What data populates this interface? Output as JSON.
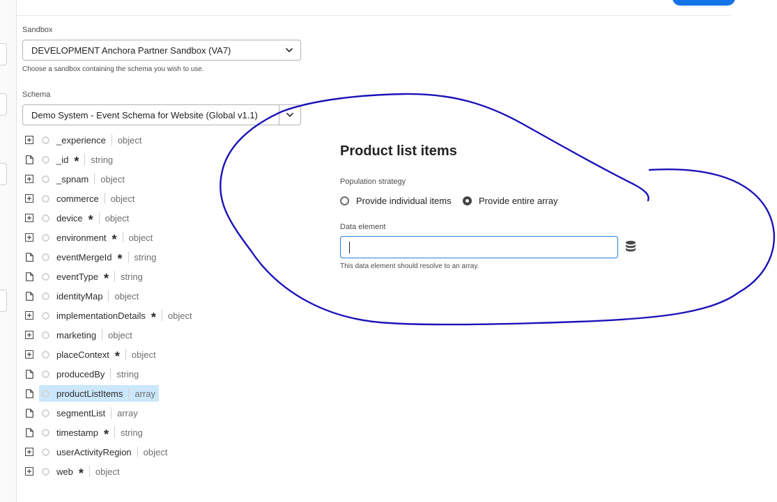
{
  "sandbox": {
    "label": "Sandbox",
    "value": "DEVELOPMENT Anchora Partner Sandbox (VA7)",
    "help": "Choose a sandbox containing the schema you wish to use."
  },
  "schema": {
    "label": "Schema",
    "value": "Demo System - Event Schema for Website (Global v1.1)"
  },
  "tree": {
    "items": [
      {
        "name": "_experience",
        "type": "object",
        "required": false,
        "expandable": true
      },
      {
        "name": "_id",
        "type": "string",
        "required": true,
        "expandable": false
      },
      {
        "name": "_spnam",
        "type": "object",
        "required": false,
        "expandable": true
      },
      {
        "name": "commerce",
        "type": "object",
        "required": false,
        "expandable": true
      },
      {
        "name": "device",
        "type": "object",
        "required": true,
        "expandable": true
      },
      {
        "name": "environment",
        "type": "object",
        "required": true,
        "expandable": true
      },
      {
        "name": "eventMergeId",
        "type": "string",
        "required": true,
        "expandable": false
      },
      {
        "name": "eventType",
        "type": "string",
        "required": true,
        "expandable": false
      },
      {
        "name": "identityMap",
        "type": "object",
        "required": false,
        "expandable": false
      },
      {
        "name": "implementationDetails",
        "type": "object",
        "required": true,
        "expandable": true
      },
      {
        "name": "marketing",
        "type": "object",
        "required": false,
        "expandable": true
      },
      {
        "name": "placeContext",
        "type": "object",
        "required": true,
        "expandable": true
      },
      {
        "name": "producedBy",
        "type": "string",
        "required": false,
        "expandable": false
      },
      {
        "name": "productListItems",
        "type": "array",
        "required": false,
        "expandable": false,
        "selected": true
      },
      {
        "name": "segmentList",
        "type": "array",
        "required": false,
        "expandable": false
      },
      {
        "name": "timestamp",
        "type": "string",
        "required": true,
        "expandable": false
      },
      {
        "name": "userActivityRegion",
        "type": "object",
        "required": false,
        "expandable": true
      },
      {
        "name": "web",
        "type": "object",
        "required": true,
        "expandable": true
      }
    ],
    "required_marker": "*"
  },
  "panel": {
    "title": "Product list items",
    "population_label": "Population strategy",
    "option_individual": "Provide individual items",
    "option_entire": "Provide entire array",
    "selected_option": "entire",
    "data_element_label": "Data element",
    "data_element_value": "",
    "data_element_help": "This data element should resolve to an array."
  },
  "colors": {
    "accent": "#1473e6",
    "selection": "#cbe7fb",
    "annotation_ink": "#1b12b8"
  }
}
